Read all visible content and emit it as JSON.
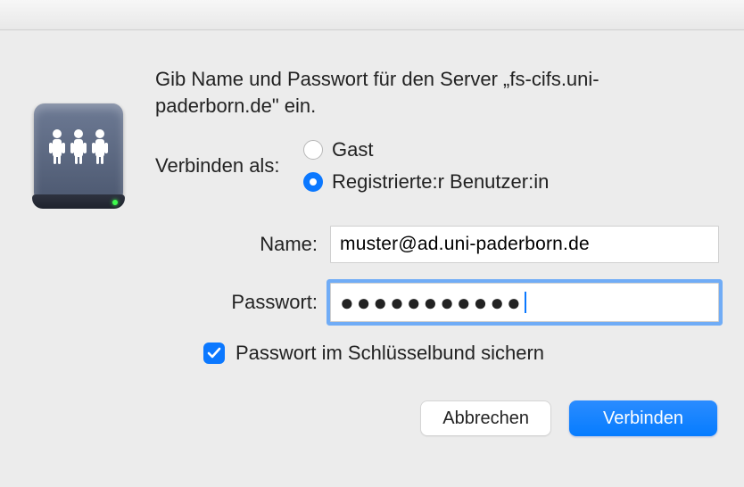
{
  "prompt": "Gib Name und Passwort für den Server „fs-cifs.uni-paderborn.de\" ein.",
  "connect_as": {
    "label": "Verbinden als:",
    "options": {
      "guest": {
        "label": "Gast",
        "selected": false
      },
      "registered": {
        "label": "Registrierte:r Benutzer:in",
        "selected": true
      }
    }
  },
  "fields": {
    "name": {
      "label": "Name:",
      "value": "muster@ad.uni-paderborn.de"
    },
    "password": {
      "label": "Passwort:",
      "dots": "●●●●●●●●●●●",
      "focused": true
    }
  },
  "remember": {
    "label": "Passwort im Schlüsselbund sichern",
    "checked": true
  },
  "buttons": {
    "cancel": "Abbrechen",
    "connect": "Verbinden"
  }
}
